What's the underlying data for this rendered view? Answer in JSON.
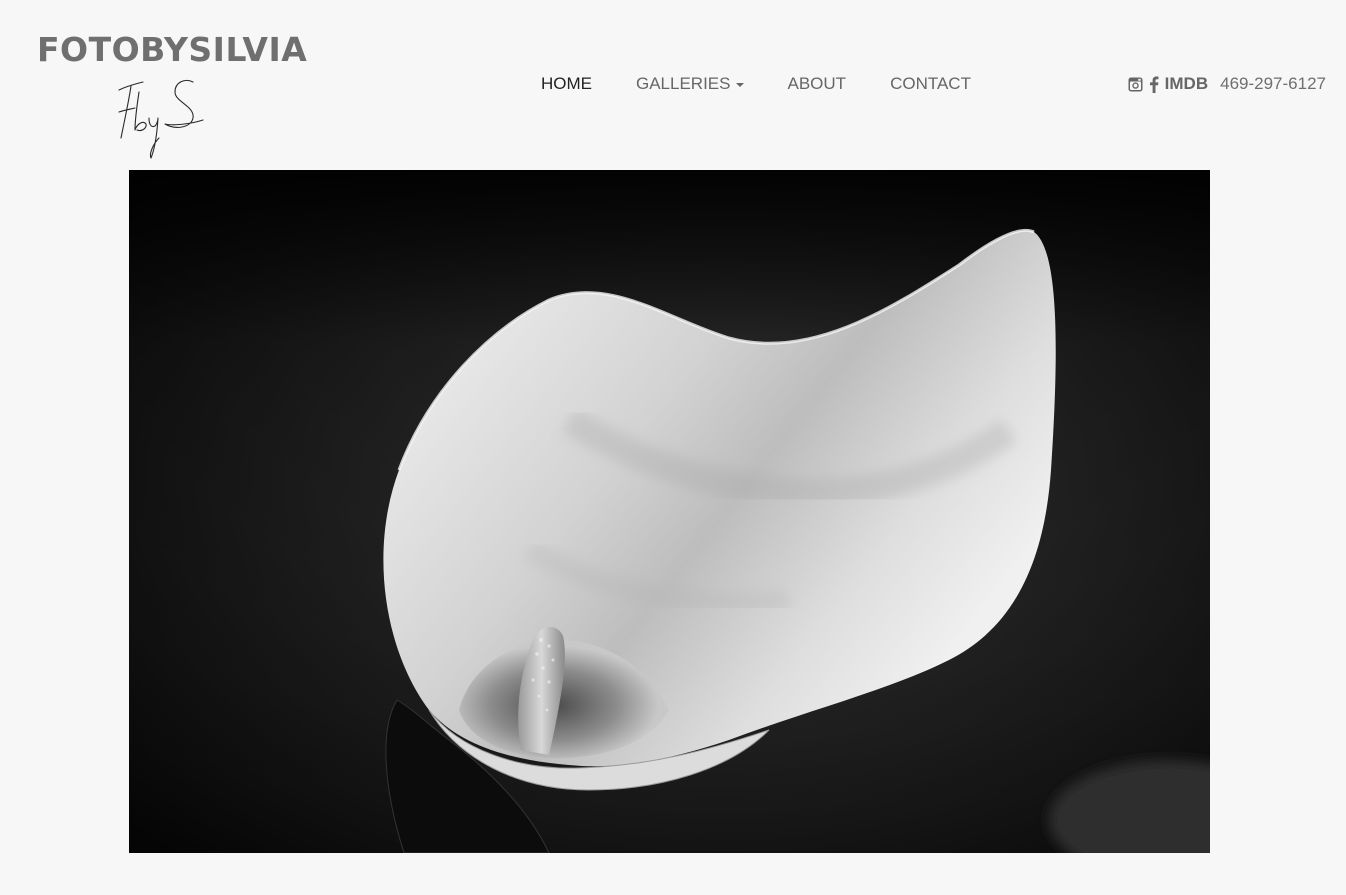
{
  "brand": {
    "name": "FOTOBYSILVIA",
    "monogram": "FbyS"
  },
  "nav": {
    "items": [
      {
        "label": "HOME",
        "active": true
      },
      {
        "label": "GALLERIES",
        "dropdown": true
      },
      {
        "label": "ABOUT"
      },
      {
        "label": "CONTACT"
      }
    ]
  },
  "social": {
    "icons": [
      "instagram-icon",
      "facebook-icon"
    ],
    "imdb_label": "IMDB",
    "phone": "469-297-6127"
  },
  "hero": {
    "subject": "calla-lily-photo"
  },
  "colors": {
    "background": "#f7f7f7",
    "nav_text": "#666666",
    "nav_active": "#222222",
    "brand_text": "#6f6f6f"
  }
}
